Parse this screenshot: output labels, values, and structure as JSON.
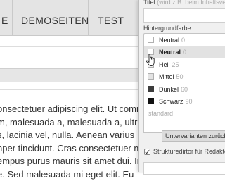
{
  "nav": {
    "items": [
      "E",
      "DEMOSEITEN",
      "TEST"
    ]
  },
  "content": {
    "lines": [
      "onsectetuer adipiscing elit. Ut comm",
      "m, malesuada a, malesuada a, ultr",
      "s, lacinia vel, nulla. Aenean varius",
      "nper tincidunt. Cras consectetuer m",
      "empus purus mauris sit amet dui. In",
      "e. Sed malesuada mi eget elit. Eu"
    ]
  },
  "settings": {
    "title_label": "Titel",
    "title_hint": "(wird z.B. beim Inhaltsve",
    "background_label": "Hintergrundfarbe",
    "selected": {
      "name": "Neutral",
      "num": "0"
    },
    "options": [
      {
        "name": "Neutral",
        "num": "0",
        "color": "#ffffff",
        "bold": true
      },
      {
        "name": "Hell",
        "num": "25",
        "color": "#f0f0f0"
      },
      {
        "name": "Mittel",
        "num": "50",
        "color": "#e3e3e3"
      },
      {
        "name": "Dunkel",
        "num": "60",
        "color": "#3c3c3c"
      },
      {
        "name": "Schwarz",
        "num": "90",
        "color": "#111111"
      }
    ],
    "standard": "standard",
    "variants_button": "Untervarianten zurück",
    "structure_label": "Strukturedirtor für Redakte"
  }
}
